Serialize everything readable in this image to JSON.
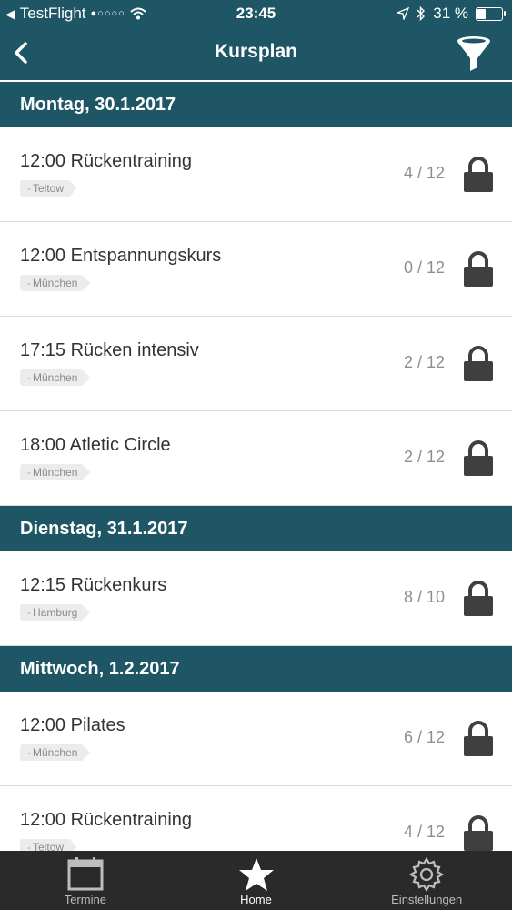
{
  "status_bar": {
    "carrier": "TestFlight",
    "signal": "●○○○○",
    "time": "23:45",
    "battery": "31 %",
    "battery_level": 0.31
  },
  "nav": {
    "title": "Kursplan",
    "back_icon": "chevron-left-icon",
    "filter_icon": "filter-funnel-icon"
  },
  "sections": [
    {
      "header": "Montag, 30.1.2017",
      "rows": [
        {
          "title": "12:00 Rückentraining",
          "location": "Teltow",
          "count": "4 / 12"
        },
        {
          "title": "12:00 Entspannungskurs",
          "location": "München",
          "count": "0 / 12"
        },
        {
          "title": "17:15 Rücken intensiv",
          "location": "München",
          "count": "2 / 12"
        },
        {
          "title": "18:00 Atletic Circle",
          "location": "München",
          "count": "2 / 12"
        }
      ]
    },
    {
      "header": "Dienstag, 31.1.2017",
      "rows": [
        {
          "title": "12:15 Rückenkurs",
          "location": "Hamburg",
          "count": "8 / 10"
        }
      ]
    },
    {
      "header": "Mittwoch, 1.2.2017",
      "rows": [
        {
          "title": "12:00 Pilates",
          "location": "München",
          "count": "6 / 12"
        },
        {
          "title": "12:00 Rückentraining",
          "location": "Teltow",
          "count": "4 / 12"
        }
      ]
    }
  ],
  "tabs": [
    {
      "label": "Termine",
      "icon": "calendar-icon",
      "active": false
    },
    {
      "label": "Home",
      "icon": "star-icon",
      "active": true
    },
    {
      "label": "Einstellungen",
      "icon": "gear-icon",
      "active": false
    }
  ],
  "colors": {
    "header_bg": "#1f5666",
    "tabbar_bg": "#2a2a2a",
    "lock": "#3f3f3f"
  }
}
